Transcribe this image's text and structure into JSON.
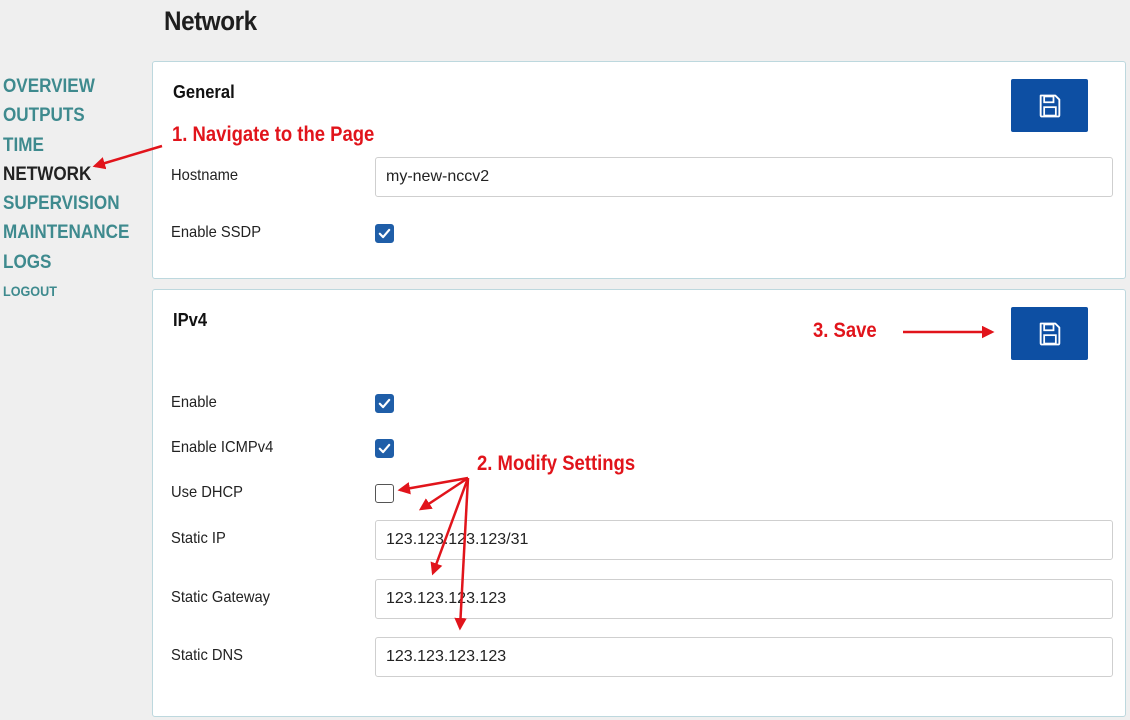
{
  "page": {
    "title": "Network"
  },
  "nav": {
    "items": [
      {
        "label": "OVERVIEW"
      },
      {
        "label": "OUTPUTS"
      },
      {
        "label": "TIME"
      },
      {
        "label": "NETWORK"
      },
      {
        "label": "SUPERVISION"
      },
      {
        "label": "MAINTENANCE"
      },
      {
        "label": "LOGS"
      },
      {
        "label": "LOGOUT"
      }
    ],
    "active": "NETWORK"
  },
  "general": {
    "title": "General",
    "hostname_label": "Hostname",
    "hostname_value": "my-new-nccv2",
    "enable_ssdp_label": "Enable SSDP",
    "enable_ssdp_checked": true,
    "save_icon": "floppy-disk-icon"
  },
  "ipv4": {
    "title": "IPv4",
    "enable_label": "Enable",
    "enable_checked": true,
    "enable_icmp_label": "Enable ICMPv4",
    "enable_icmp_checked": true,
    "use_dhcp_label": "Use DHCP",
    "use_dhcp_checked": false,
    "static_ip_label": "Static IP",
    "static_ip_value": "123.123.123.123/31",
    "static_gateway_label": "Static Gateway",
    "static_gateway_value": "123.123.123.123",
    "static_dns_label": "Static DNS",
    "static_dns_value": "123.123.123.123",
    "save_icon": "floppy-disk-icon"
  },
  "annotations": {
    "step1": "1. Navigate to the Page",
    "step2": "2. Modify Settings",
    "step3": "3. Save"
  },
  "colors": {
    "nav": "#3e8a8e",
    "nav_active": "#222222",
    "button": "#0d4fa3",
    "checkbox": "#1f5ea8",
    "annotation": "#e1141b",
    "card_border": "#bdd8de"
  }
}
